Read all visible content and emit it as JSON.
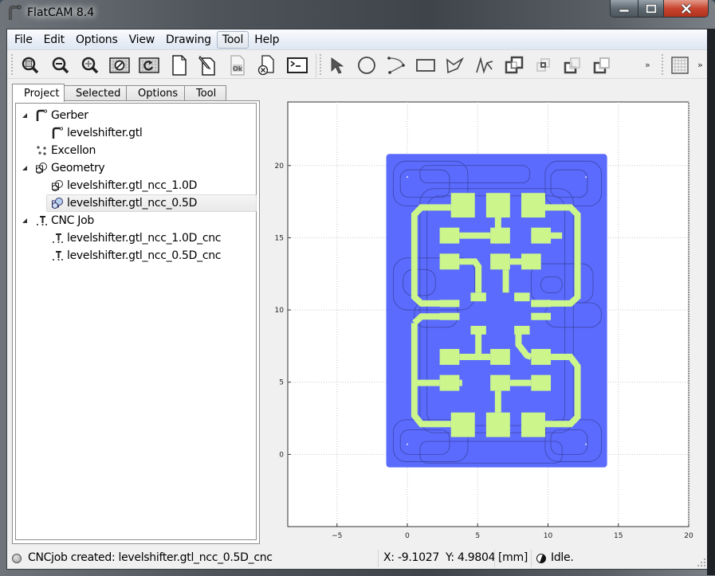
{
  "window": {
    "title": "FlatCAM 8.4"
  },
  "menubar": {
    "items": [
      {
        "label": "File",
        "active": false
      },
      {
        "label": "Edit",
        "active": false
      },
      {
        "label": "Options",
        "active": false
      },
      {
        "label": "View",
        "active": false
      },
      {
        "label": "Drawing",
        "active": false
      },
      {
        "label": "Tool",
        "active": true
      },
      {
        "label": "Help",
        "active": false
      }
    ]
  },
  "toolbar": {
    "main_buttons": [
      {
        "name": "zoom-fit",
        "icon": "zoom-fit-icon"
      },
      {
        "name": "zoom-out",
        "icon": "zoom-out-icon"
      },
      {
        "name": "zoom-in",
        "icon": "zoom-in-icon"
      },
      {
        "name": "clear-plot",
        "icon": "clear-plot-icon"
      },
      {
        "name": "replot",
        "icon": "replot-icon"
      },
      {
        "name": "new-geometry",
        "icon": "new-document-icon"
      },
      {
        "name": "edit-geometry",
        "icon": "edit-document-icon"
      },
      {
        "name": "update-geometry",
        "icon": "ok-document-icon"
      },
      {
        "name": "delete-object",
        "icon": "delete-document-icon"
      },
      {
        "name": "shell",
        "icon": "terminal-icon"
      }
    ],
    "draw_buttons": [
      {
        "name": "select",
        "icon": "arrow-pointer-icon"
      },
      {
        "name": "add-circle",
        "icon": "circle-icon"
      },
      {
        "name": "add-arc",
        "icon": "arc-icon"
      },
      {
        "name": "add-rectangle",
        "icon": "rectangle-icon"
      },
      {
        "name": "add-polygon",
        "icon": "polygon-icon"
      },
      {
        "name": "add-path",
        "icon": "path-icon"
      },
      {
        "name": "union",
        "icon": "union-icon"
      },
      {
        "name": "intersection",
        "icon": "intersection-icon"
      },
      {
        "name": "subtract",
        "icon": "subtract-icon"
      },
      {
        "name": "cut",
        "icon": "cut-icon"
      }
    ],
    "overflow_label": "»",
    "grid_button": {
      "name": "snap-grid",
      "icon": "grid-icon"
    }
  },
  "tabs": [
    {
      "label": "Project",
      "active": true
    },
    {
      "label": "Selected",
      "active": false
    },
    {
      "label": "Options",
      "active": false
    },
    {
      "label": "Tool",
      "active": false
    }
  ],
  "project_tree": [
    {
      "label": "Gerber",
      "level": 0,
      "expanded": true,
      "icon": "gerber-icon",
      "selected": false
    },
    {
      "label": "levelshifter.gtl",
      "level": 1,
      "icon": "gerber-icon",
      "selected": false
    },
    {
      "label": "Excellon",
      "level": 0,
      "expanded": null,
      "icon": "excellon-icon",
      "selected": false
    },
    {
      "label": "Geometry",
      "level": 0,
      "expanded": true,
      "icon": "geometry-icon",
      "selected": false
    },
    {
      "label": "levelshifter.gtl_ncc_1.0D",
      "level": 1,
      "icon": "geometry-icon",
      "selected": false
    },
    {
      "label": "levelshifter.gtl_ncc_0.5D",
      "level": 1,
      "icon": "geometry-icon",
      "selected": true
    },
    {
      "label": "CNC Job",
      "level": 0,
      "expanded": true,
      "icon": "cncjob-icon",
      "selected": false
    },
    {
      "label": "levelshifter.gtl_ncc_1.0D_cnc",
      "level": 1,
      "icon": "cncjob-icon",
      "selected": false
    },
    {
      "label": "levelshifter.gtl_ncc_0.5D_cnc",
      "level": 1,
      "icon": "cncjob-icon",
      "selected": false
    }
  ],
  "plot": {
    "xticks": [
      "−5",
      "0",
      "5",
      "10",
      "15",
      "20"
    ],
    "yticks": [
      "0",
      "5",
      "10",
      "15",
      "20"
    ],
    "xlim": [
      -8.5,
      20
    ],
    "ylim": [
      -5,
      24.4
    ],
    "board_color": "#5b6bfd",
    "copper_color": "#ccf58c",
    "outline_color": "#3c46a8"
  },
  "statusbar": {
    "message": "CNCjob created: levelshifter.gtl_ncc_0.5D_cnc",
    "x_label": "X:",
    "x_value": "-9.1027",
    "y_label": "Y:",
    "y_value": "4.9804",
    "units": "[mm]",
    "activity": "Idle."
  }
}
